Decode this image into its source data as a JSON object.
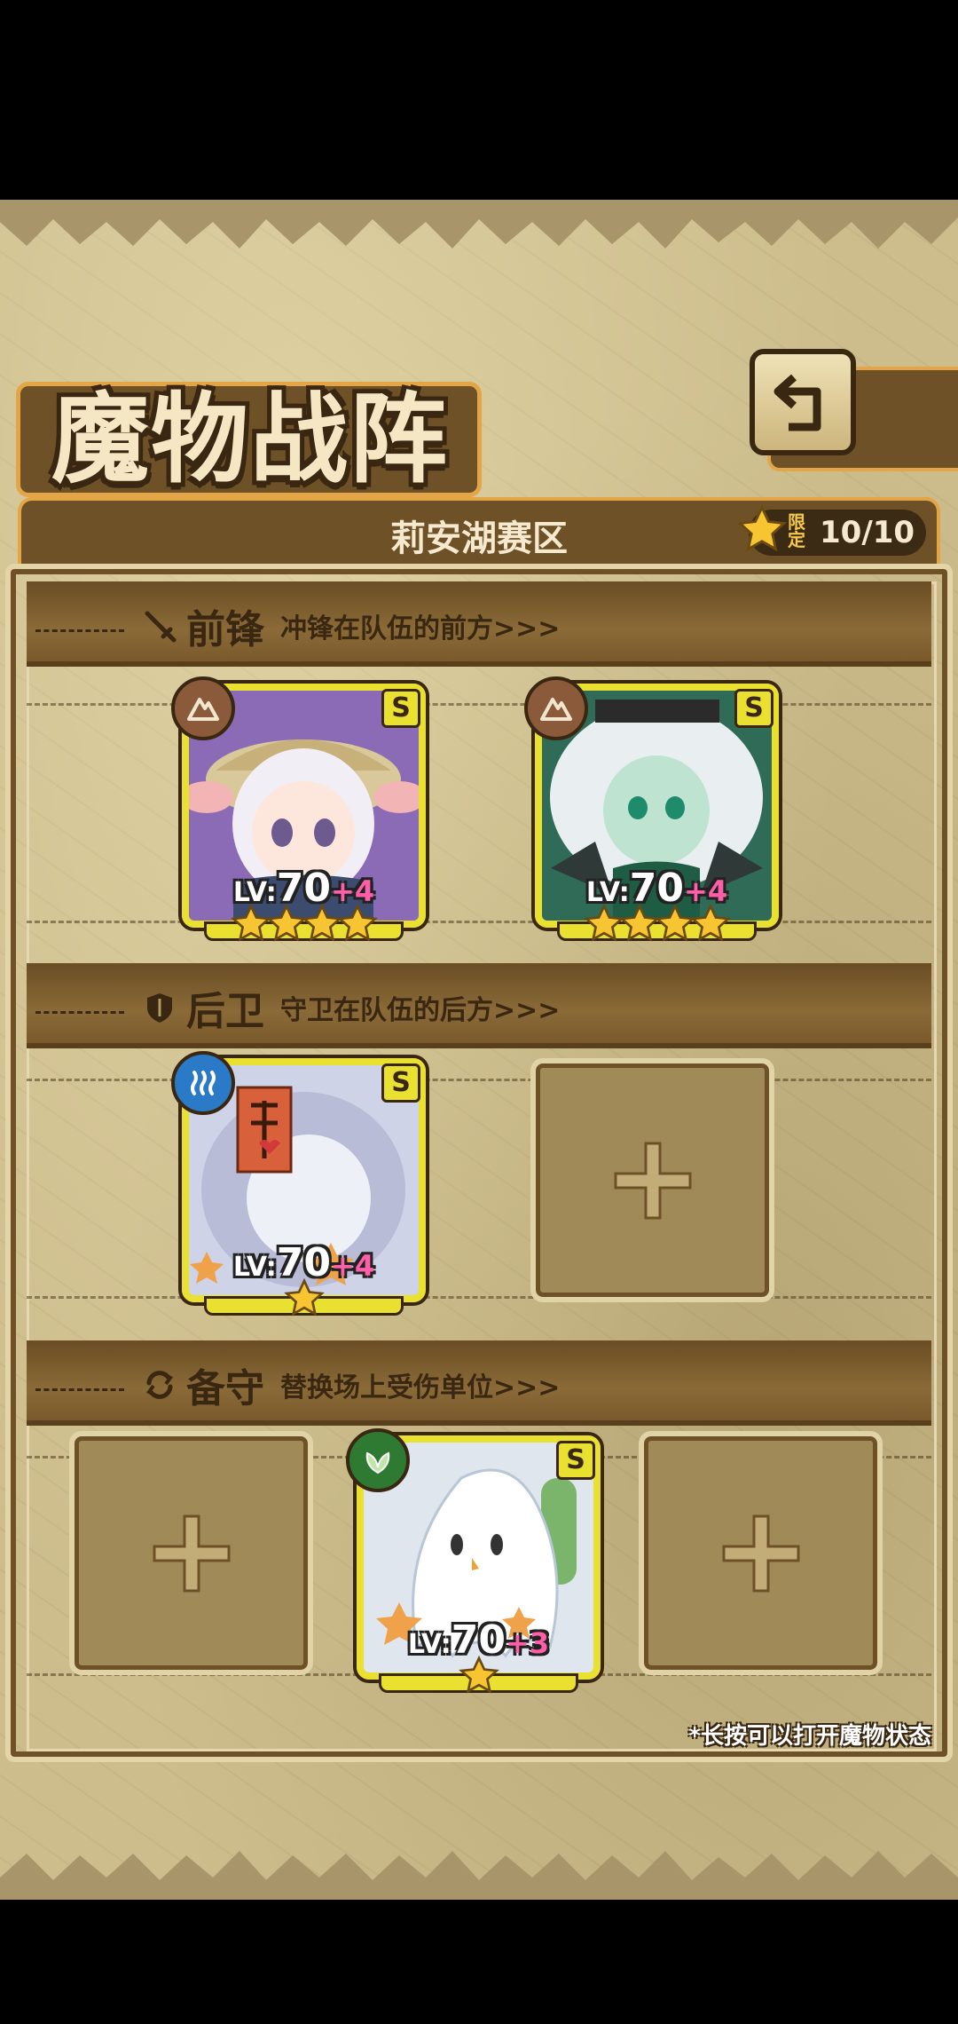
{
  "title": "魔物战阵",
  "region": {
    "name": "莉安湖赛区",
    "limit_label": "限定",
    "limit_value": "10/10"
  },
  "sections": {
    "front": {
      "title": "前锋",
      "subtitle": "冲锋在队伍的前方>>>"
    },
    "rear": {
      "title": "后卫",
      "subtitle": "守卫在队伍的后方>>>"
    },
    "reserve": {
      "title": "备守",
      "subtitle": "替换场上受伤单位>>>"
    }
  },
  "cards": {
    "front_1": {
      "rank": "S",
      "level_prefix": "LV:",
      "level": "70",
      "plus": "+4",
      "element": "earth",
      "stars": 4,
      "portrait": "white-haired girl with straw hat",
      "colors": {
        "bg": "#8b6bb5",
        "hair": "#f1eef5"
      }
    },
    "front_2": {
      "rank": "S",
      "level_prefix": "LV:",
      "level": "70",
      "plus": "+4",
      "element": "earth",
      "stars": 4,
      "portrait": "pale green winged girl",
      "colors": {
        "bg": "#2f6b57",
        "hair": "#e9eef0"
      }
    },
    "rear_1": {
      "rank": "S",
      "level_prefix": "LV:",
      "level": "70",
      "plus": "+4",
      "element": "water",
      "stars": 1,
      "portrait": "jiangshi ghost girl with talisman",
      "colors": {
        "bg": "#cfd3e8",
        "hair": "#b9bcd6"
      }
    },
    "reserve_2": {
      "rank": "S",
      "level_prefix": "LV:",
      "level": "70",
      "plus": "+3",
      "element": "nature",
      "stars": 1,
      "portrait": "white sheet ghost",
      "colors": {
        "bg": "#dfe6ee",
        "hair": "#ffffff"
      }
    }
  },
  "hint": "*长按可以打开魔物状态",
  "icons": {
    "back": "back-arrow-icon",
    "star": "star-icon",
    "earth": "mountain-icon",
    "water": "waves-icon",
    "nature": "leaf-icon",
    "plus": "plus-icon"
  }
}
